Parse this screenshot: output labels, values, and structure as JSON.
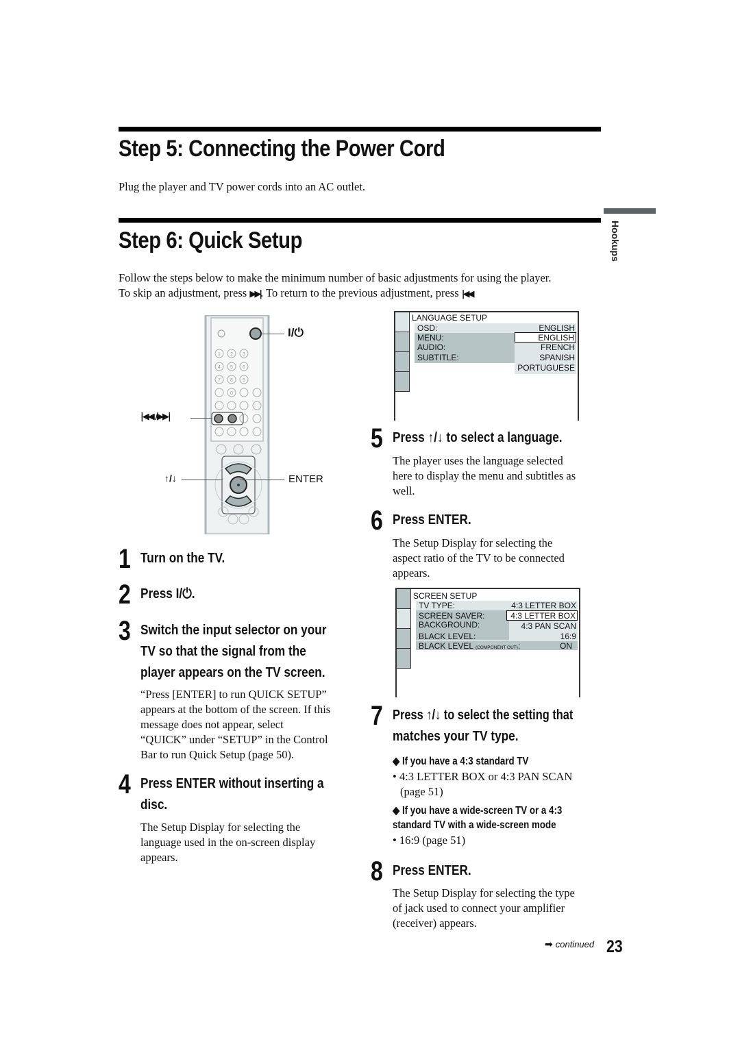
{
  "section5": {
    "title": "Step 5: Connecting the Power Cord",
    "body": "Plug the player and TV power cords into an AC outlet."
  },
  "section6": {
    "title": "Step 6: Quick Setup",
    "intro_line1": "Follow the steps below to make the minimum number of basic adjustments for using the player.",
    "intro_line2_a": "To skip an adjustment, press ",
    "intro_line2_b": ". To return to the previous adjustment, press ",
    "intro_line2_c": ".",
    "next_icon": "▶▶|",
    "prev_icon": "|◀◀"
  },
  "side_tab": {
    "label": "Hookups"
  },
  "remote": {
    "power_label": "I/⏻",
    "skip_label": "|◀◀ /▶▶|",
    "updown_label": "↑/↓",
    "enter_label": "ENTER",
    "number_buttons": [
      "1",
      "2",
      "3",
      "4",
      "5",
      "6",
      "7",
      "8",
      "9",
      "",
      "0",
      "",
      ""
    ]
  },
  "steps": [
    {
      "num": "1",
      "title": "Turn on the TV."
    },
    {
      "num": "2",
      "title": "Press I/⏻."
    },
    {
      "num": "3",
      "title_lines": [
        "Switch the input selector on your",
        "TV so that the signal from the",
        "player appears on the TV screen."
      ],
      "desc_lines": [
        "“Press [ENTER] to run QUICK SETUP”",
        "appears at the bottom of the screen. If this",
        "message does not appear, select",
        "“QUICK” under “SETUP” in the Control",
        "Bar to run Quick Setup (page 50)."
      ]
    },
    {
      "num": "4",
      "title_lines": [
        "Press ENTER without inserting a",
        "disc."
      ],
      "desc_lines": [
        "The Setup Display for selecting the",
        "language used in the on-screen display",
        "appears."
      ]
    },
    {
      "num": "5",
      "title": "Press ↑/↓ to select a language.",
      "desc_lines": [
        "The player uses the language selected",
        "here to display the menu and subtitles as",
        "well."
      ]
    },
    {
      "num": "6",
      "title": "Press ENTER.",
      "desc_lines": [
        "The Setup Display for selecting the",
        "aspect ratio of the TV to be connected",
        "appears."
      ]
    },
    {
      "num": "7",
      "title_lines": [
        "Press ↑/↓ to select the setting that",
        "matches your TV type."
      ],
      "sub1": "◆ If you have a 4:3 standard TV",
      "sub1_bullet_lines": [
        "• 4:3 LETTER BOX or 4:3 PAN SCAN",
        "(page 51)"
      ],
      "sub2_lines": [
        "◆ If you have a wide-screen TV or a 4:3",
        "standard TV with a wide-screen mode"
      ],
      "sub2_bullet": "• 16:9 (page 51)"
    },
    {
      "num": "8",
      "title": "Press ENTER.",
      "desc_lines": [
        "The Setup Display for selecting the type",
        "of jack used to connect your amplifier",
        "(receiver) appears."
      ]
    }
  ],
  "language_setup": {
    "title": "LANGUAGE SETUP",
    "rows": [
      {
        "label": "OSD:",
        "value": "ENGLISH"
      },
      {
        "label": "MENU:",
        "value": "ENGLISH",
        "selected": true
      },
      {
        "label": "AUDIO:",
        "value": "FRENCH"
      },
      {
        "label": "SUBTITLE:",
        "value": "SPANISH"
      },
      {
        "label": "",
        "value": "PORTUGUESE"
      }
    ]
  },
  "screen_setup": {
    "title": "SCREEN SETUP",
    "rows": [
      {
        "label": "TV TYPE:",
        "value": "4:3 LETTER BOX"
      },
      {
        "label": "SCREEN SAVER:",
        "value": "4:3 LETTER BOX",
        "selected": true
      },
      {
        "label": "BACKGROUND:",
        "value": "4:3 PAN SCAN"
      },
      {
        "label": "BLACK LEVEL:",
        "value": "16:9"
      },
      {
        "label": "BLACK LEVEL",
        "label_small": "(COMPONENT OUT)",
        "label_suffix": ":",
        "value": "ON"
      }
    ]
  },
  "footer": {
    "continued": "continued",
    "arrow": "➡",
    "page_number": "23"
  }
}
